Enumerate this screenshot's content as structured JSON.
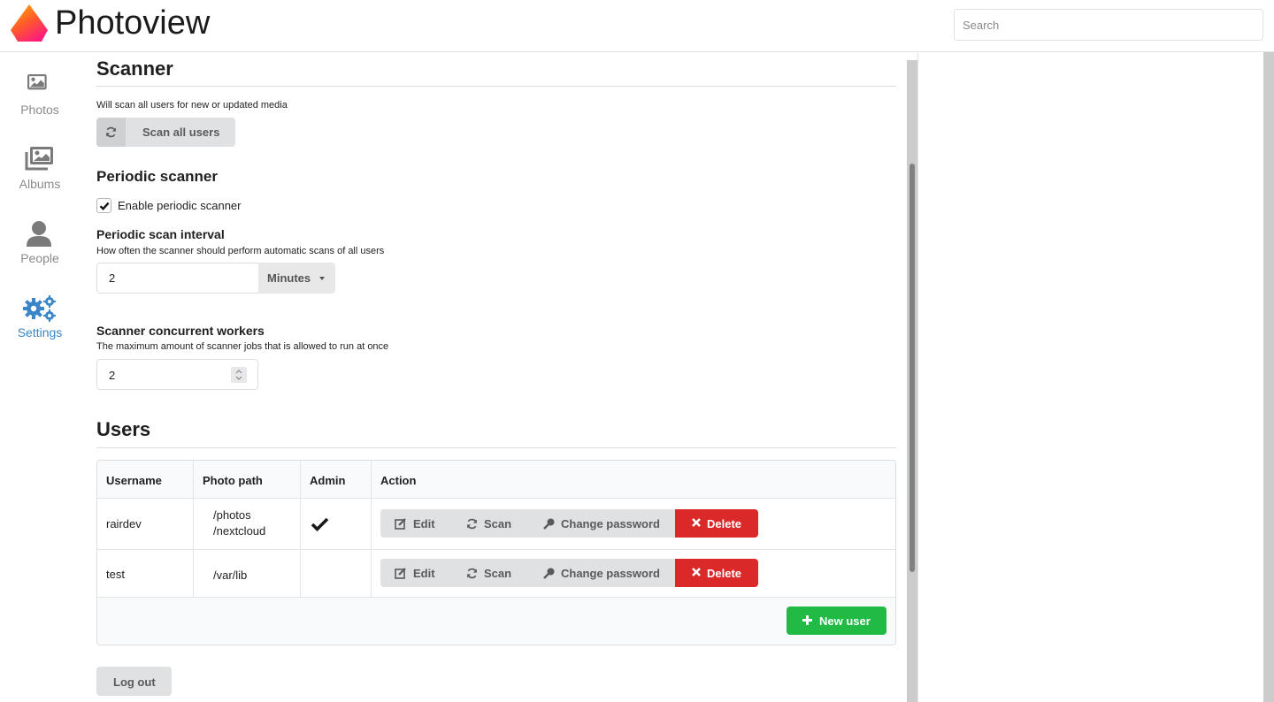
{
  "header": {
    "app_title": "Photoview",
    "search_placeholder": "Search"
  },
  "sidebar": {
    "items": [
      {
        "label": "Photos",
        "icon": "image-icon",
        "active": false
      },
      {
        "label": "Albums",
        "icon": "images-icon",
        "active": false
      },
      {
        "label": "People",
        "icon": "user-icon",
        "active": false
      },
      {
        "label": "Settings",
        "icon": "cogs-icon",
        "active": true
      }
    ]
  },
  "scanner": {
    "title": "Scanner",
    "description": "Will scan all users for new or updated media",
    "scan_all_label": "Scan all users",
    "periodic": {
      "title": "Periodic scanner",
      "enable_label": "Enable periodic scanner",
      "enabled": true,
      "interval_title": "Periodic scan interval",
      "interval_description": "How often the scanner should perform automatic scans of all users",
      "interval_value": "2",
      "interval_unit": "Minutes"
    },
    "workers": {
      "title": "Scanner concurrent workers",
      "description": "The maximum amount of scanner jobs that is allowed to run at once",
      "value": "2"
    }
  },
  "users": {
    "title": "Users",
    "columns": [
      "Username",
      "Photo path",
      "Admin",
      "Action"
    ],
    "rows": [
      {
        "username": "rairdev",
        "paths": [
          "/photos",
          "/nextcloud"
        ],
        "admin": true
      },
      {
        "username": "test",
        "paths": [
          "/var/lib"
        ],
        "admin": false
      }
    ],
    "actions": {
      "edit": "Edit",
      "scan": "Scan",
      "change_password": "Change password",
      "delete": "Delete"
    },
    "new_user_label": "New user"
  },
  "logout_label": "Log out",
  "colors": {
    "accent": "#3a86c8",
    "danger": "#db2828",
    "success": "#21ba45",
    "button_gray": "#e0e1e2"
  }
}
